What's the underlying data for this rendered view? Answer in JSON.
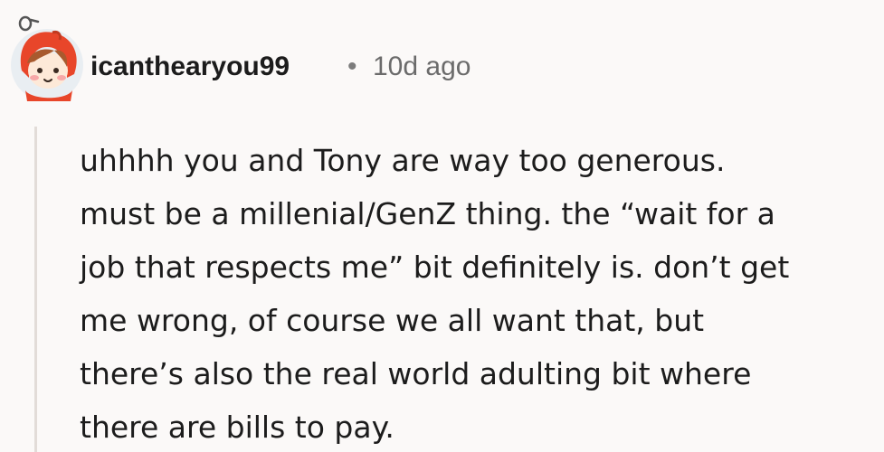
{
  "comment": {
    "author": "icanthearyou99",
    "separator": "•",
    "age": "10d ago",
    "avatar_icon": "snoo-avatar-red-hood-icon",
    "body": "uhhhh you and Tony are way too generous.\nmust be a millenial/GenZ thing. the “wait for a\njob that respects me” bit definitely is. don’t get\nme wrong, of course we all want that, but\nthere’s also the real world adulting bit where\nthere are bills to pay."
  },
  "colors": {
    "background": "#fbf9f8",
    "text": "#1c1c1c",
    "meta": "#6b6b6b",
    "thread_line": "#e2dcd8",
    "avatar_hood": "#e8462a"
  }
}
